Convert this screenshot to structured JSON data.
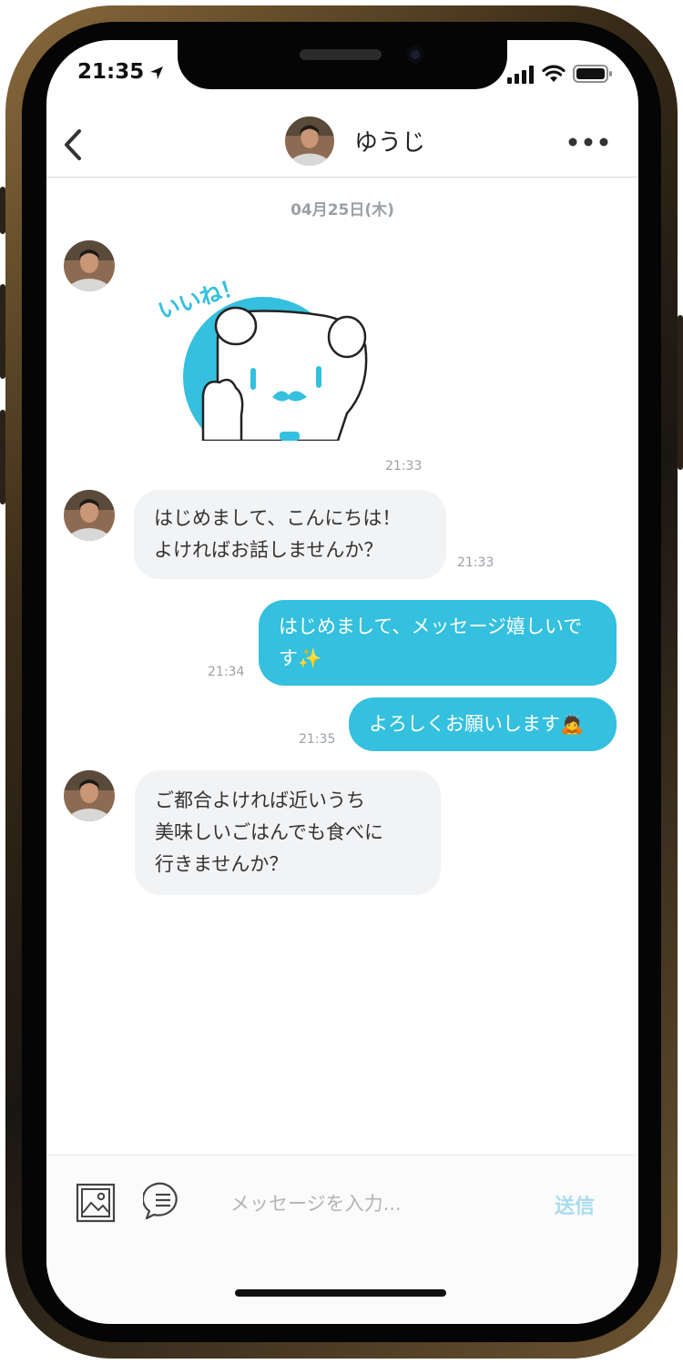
{
  "status_bar": {
    "time": "21:35"
  },
  "header": {
    "name": "ゆうじ"
  },
  "chat": {
    "date": "04月25日(木)",
    "sticker": {
      "text": "いいね！",
      "time": "21:33"
    },
    "messages": [
      {
        "from": "them",
        "lines": [
          "はじめまして、こんにちは！",
          "よければお話しませんか？"
        ],
        "time": "21:33"
      },
      {
        "from": "me",
        "lines": [
          "はじめまして、メッセージ嬉しいで",
          "す✨"
        ],
        "time": "21:34"
      },
      {
        "from": "me",
        "lines": [
          "よろしくお願いします🙇"
        ],
        "time": "21:35"
      },
      {
        "from": "them",
        "lines": [
          "ご都合よければ近いうち",
          "美味しいごはんでも食べに",
          "行きませんか？"
        ],
        "time": ""
      }
    ]
  },
  "composer": {
    "placeholder": "メッセージを入力...",
    "send_label": "送信"
  },
  "colors": {
    "accent": "#34c0de",
    "incoming_bubble": "#f2f3f5",
    "send_disabled": "#a9dcee"
  }
}
